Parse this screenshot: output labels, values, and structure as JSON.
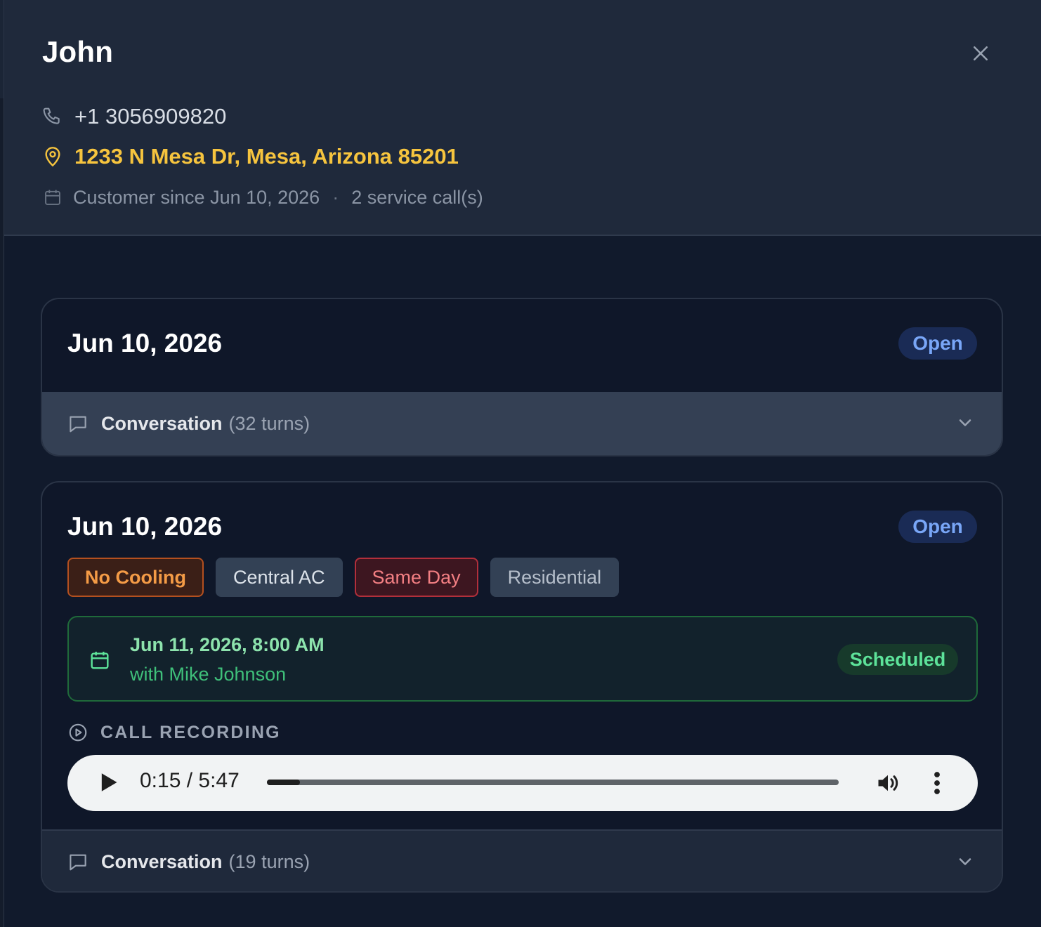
{
  "customer": {
    "name": "John",
    "phone": "+1 3056909820",
    "address": "1233 N Mesa Dr, Mesa, Arizona 85201",
    "since": "Customer since Jun 10, 2026",
    "separator": "·",
    "service_calls": "2 service call(s)"
  },
  "icons": {
    "close": "close-icon",
    "phone": "phone-icon",
    "location": "map-pin-icon",
    "calendar": "calendar-icon",
    "chat": "chat-bubble-icon",
    "chevron": "chevron-down-icon",
    "play_circle": "play-circle-icon",
    "play": "play-icon",
    "volume": "volume-icon",
    "more": "more-vertical-icon"
  },
  "calls": [
    {
      "date": "Jun 10, 2026",
      "status": "Open",
      "conversation": {
        "label": "Conversation",
        "count": "(32 turns)"
      }
    },
    {
      "date": "Jun 10, 2026",
      "status": "Open",
      "tags": [
        "No Cooling",
        "Central AC",
        "Same Day",
        "Residential"
      ],
      "appointment": {
        "when": "Jun 11, 2026, 8:00 AM",
        "with": "with Mike Johnson",
        "status": "Scheduled"
      },
      "recording": {
        "label": "CALL RECORDING",
        "time": "0:15 / 5:47",
        "progress_fraction": 0.0576
      },
      "conversation": {
        "label": "Conversation",
        "count": "(19 turns)"
      }
    }
  ],
  "colors": {
    "accent_address": "#f6c43e",
    "status_open": "#79a6f7",
    "status_scheduled": "#5de39a",
    "tag_no_cooling": "#f49b46",
    "tag_same_day": "#f37f83"
  }
}
